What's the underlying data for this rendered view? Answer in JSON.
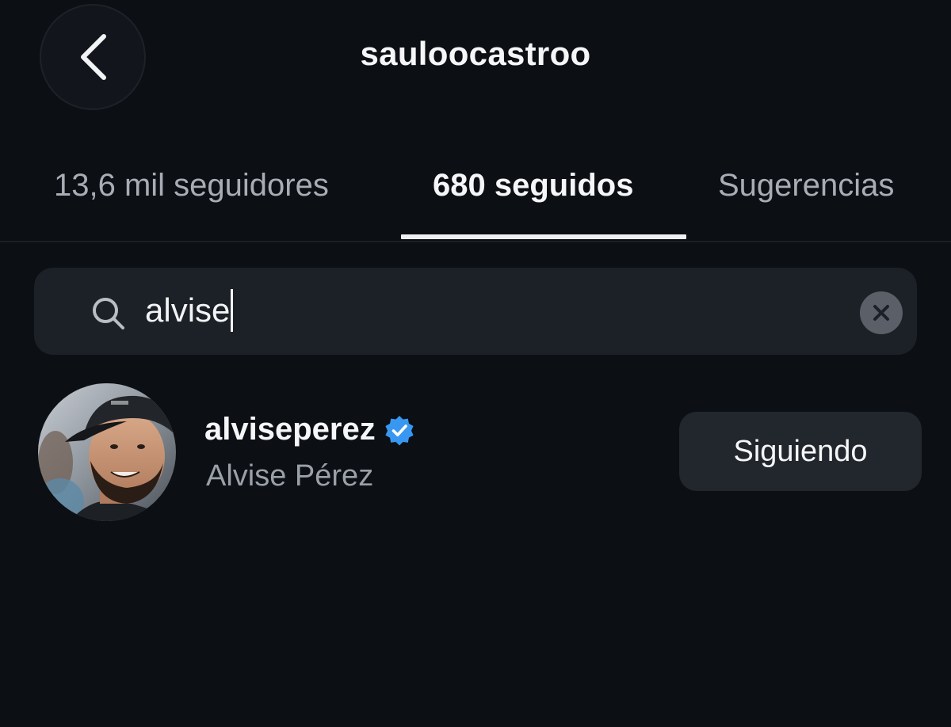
{
  "header": {
    "title": "sauloocastroo",
    "back_icon": "chevron-left-icon"
  },
  "tabs": [
    {
      "label": "13,6 mil seguidores",
      "active": false
    },
    {
      "label": "680 seguidos",
      "active": true
    },
    {
      "label": "Sugerencias",
      "active": false
    }
  ],
  "search": {
    "value": "alvise",
    "icon": "search-icon",
    "clear_icon": "clear-icon"
  },
  "results": [
    {
      "username": "alviseperez",
      "verified": true,
      "full_name": "Alvise Pérez",
      "button_label": "Siguiendo"
    }
  ],
  "colors": {
    "background": "#0c0f14",
    "search_bg": "#1c2027",
    "button_bg": "#22262d",
    "verified_blue": "#3897f0",
    "secondary_text": "#9aa0a8"
  }
}
